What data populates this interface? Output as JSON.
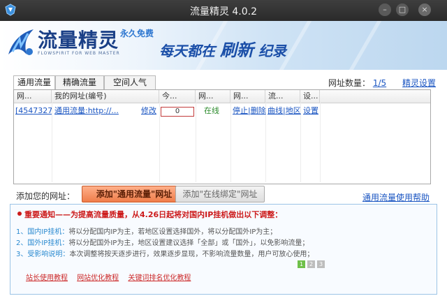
{
  "window": {
    "title": "流量精灵 4.0.2",
    "controls": [
      "minimize-icon",
      "maximize-icon",
      "close-icon"
    ]
  },
  "banner": {
    "app_name": "流量精灵",
    "free_badge": "永久免费",
    "subtitle": "FLOWSPIRIT FOR WEB MASTER",
    "slogan_part1": "每天都在",
    "slogan_part2": "刷新",
    "slogan_part3": "纪录"
  },
  "tabs": [
    {
      "label": "通用流量",
      "active": true
    },
    {
      "label": "精确流量",
      "active": false
    },
    {
      "label": "空间人气",
      "active": false
    }
  ],
  "url_count": {
    "label": "网址数量：",
    "value": "1/5"
  },
  "settings_link": "精灵设置",
  "table": {
    "columns": [
      "网...",
      "我的网址(编号)",
      "今...",
      "网...",
      "网...",
      "流...",
      "设..."
    ],
    "rows": [
      {
        "id": "[4547327]",
        "url": "通用流量:http://...",
        "edit": "修改",
        "progress": 0,
        "progress_text": "0",
        "status": "在线",
        "actions": "停止|删除",
        "region": "曲线|地区",
        "settings": "设置"
      }
    ]
  },
  "add": {
    "label": "添加您的网址：",
    "btn_general": "添加\"通用流量\"网址",
    "btn_online": "添加\"在线绑定\"网址",
    "help": "通用流量使用帮助"
  },
  "notice": {
    "title": "重要通知——为提高流量质量，从4.26日起将对国内IP挂机做出以下调整：",
    "lines": [
      {
        "num": "1、国内IP挂机：",
        "text": "将以分配国内IP为主，若地区设置选择国外，将以分配国外IP为主；"
      },
      {
        "num": "2、国外IP挂机：",
        "text": "将以分配国外IP为主，地区设置建议选择「全部」或「国外」，以免影响流量；"
      },
      {
        "num": "3、受影响说明：",
        "text": "本次调整将按天逐步进行，效果逐步显现，不影响流量数量，用户可放心使用；"
      }
    ],
    "pages": [
      "1",
      "2",
      "3"
    ],
    "active_page": "1",
    "links": [
      "站长使用教程",
      "网站优化教程",
      "关键词排名优化教程"
    ]
  },
  "colors": {
    "accent": "#1a55c2",
    "add_button": "#ef7d4a",
    "status_online": "#2a8a2a",
    "notice_title": "#cc1a1a"
  }
}
